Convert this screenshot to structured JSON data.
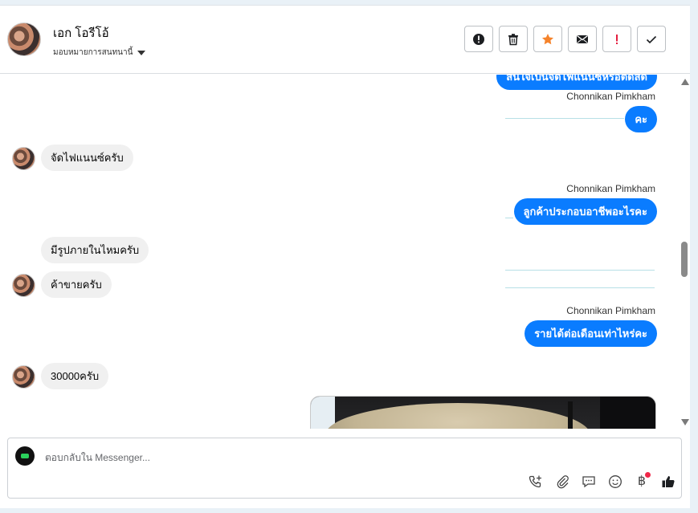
{
  "header": {
    "contact_name": "เอก โอรีโอ้",
    "assign_label": "มอบหมายการสนทนานี้",
    "actions": [
      {
        "icon": "alert-circle-icon"
      },
      {
        "icon": "trash-icon"
      },
      {
        "icon": "star-icon",
        "color": "#f5832b"
      },
      {
        "icon": "mail-icon"
      },
      {
        "icon": "exclamation-icon",
        "color": "#e41e3f"
      },
      {
        "icon": "check-icon"
      }
    ]
  },
  "messages": {
    "m0": {
      "text": "สนใจเป็นจัดไฟแนนซ์หรือตัดสด"
    },
    "s1": {
      "sender": "Chonnikan Pimkham"
    },
    "m1": {
      "text": "คะ"
    },
    "m2": {
      "text": "จัดไฟแนนซ์ครับ"
    },
    "s3": {
      "sender": "Chonnikan Pimkham"
    },
    "m3": {
      "text": "ลูกค้าประกอบอาชีพอะไรคะ"
    },
    "m4": {
      "text": "มีรูปภายในไหมครับ"
    },
    "m5": {
      "text": "ค้าขายครับ"
    },
    "s6": {
      "sender": "Chonnikan Pimkham"
    },
    "m6": {
      "text": "รายได้ต่อเดือนเท่าไหร่คะ"
    },
    "m7": {
      "text": "30000ครับ"
    }
  },
  "composer": {
    "placeholder": "ตอบกลับใน Messenger...",
    "baht_symbol": "฿"
  },
  "colors": {
    "outgoing_bubble": "#0a7cff",
    "incoming_bubble": "#f0f0f0",
    "notification_dot": "#f02849"
  }
}
